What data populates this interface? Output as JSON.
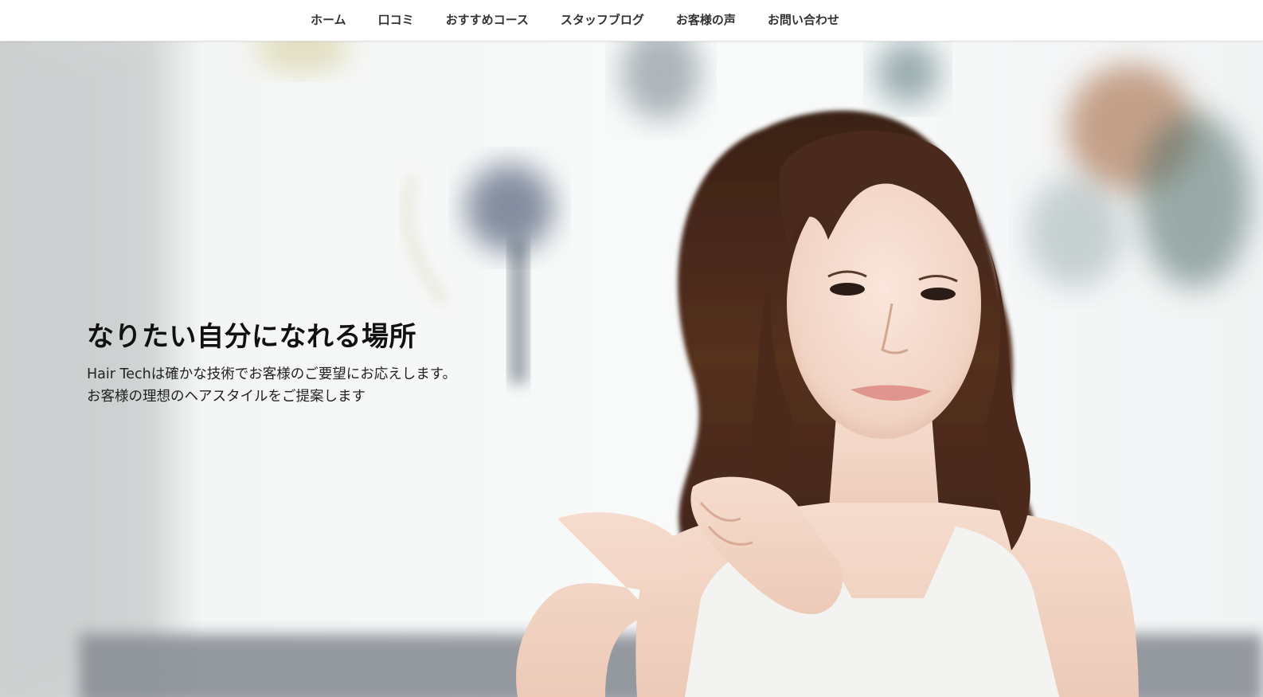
{
  "nav": {
    "items": [
      {
        "label": "ホーム"
      },
      {
        "label": "口コミ"
      },
      {
        "label": "おすすめコース"
      },
      {
        "label": "スタッフブログ"
      },
      {
        "label": "お客様の声"
      },
      {
        "label": "お問い合わせ"
      }
    ]
  },
  "hero": {
    "headline": "なりたい自分になれる場所",
    "description_line1": "Hair Techは確かな技術でお客様のご要望にお応えします。",
    "description_line2": "お客様の理想のヘアスタイルをご提案します"
  },
  "colors": {
    "nav_text": "#333333",
    "headline_text": "#111111",
    "hero_background": "#f4f6f7",
    "hair": "#4a2a1c",
    "skin": "#f3d8c8"
  }
}
